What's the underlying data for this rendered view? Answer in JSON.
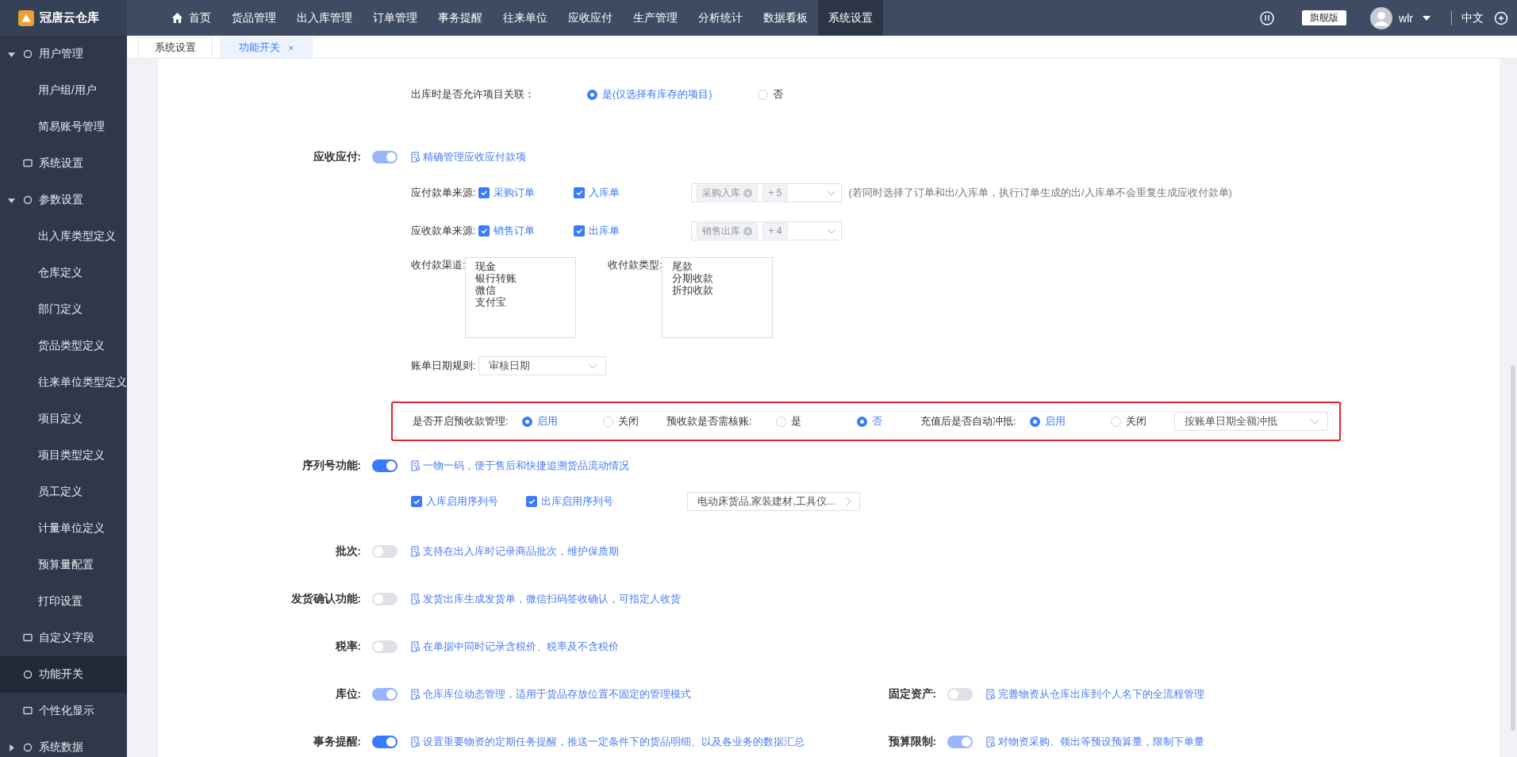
{
  "topbar": {
    "logo_text": "冠唐云仓库",
    "nav": [
      {
        "label": "首页",
        "selected": false
      },
      {
        "label": "货品管理",
        "selected": false
      },
      {
        "label": "出入库管理",
        "selected": false
      },
      {
        "label": "订单管理",
        "selected": false
      },
      {
        "label": "事务提醒",
        "selected": false
      },
      {
        "label": "往来单位",
        "selected": false
      },
      {
        "label": "应收应付",
        "selected": false
      },
      {
        "label": "生产管理",
        "selected": false
      },
      {
        "label": "分析统计",
        "selected": false
      },
      {
        "label": "数据看板",
        "selected": false
      },
      {
        "label": "系统设置",
        "selected": true
      }
    ],
    "edition": "旗舰版",
    "user": "wlr",
    "language": "中文"
  },
  "sidebar": {
    "items": [
      {
        "label": "用户管理",
        "selected": false,
        "expanded": true,
        "children": [
          {
            "label": "用户组/用户",
            "selected": false
          },
          {
            "label": "简易账号管理",
            "selected": false
          }
        ]
      },
      {
        "label": "系统设置",
        "selected": false
      },
      {
        "label": "参数设置",
        "selected": false,
        "expanded": true,
        "children": [
          {
            "label": "出入库类型定义",
            "selected": false
          },
          {
            "label": "仓库定义",
            "selected": false
          },
          {
            "label": "部门定义",
            "selected": false
          },
          {
            "label": "货品类型定义",
            "selected": false
          },
          {
            "label": "往来单位类型定义",
            "selected": false
          },
          {
            "label": "项目定义",
            "selected": false
          },
          {
            "label": "项目类型定义",
            "selected": false
          },
          {
            "label": "员工定义",
            "selected": false
          },
          {
            "label": "计量单位定义",
            "selected": false
          },
          {
            "label": "预算量配置",
            "selected": false
          },
          {
            "label": "打印设置",
            "selected": false
          }
        ]
      },
      {
        "label": "自定义字段",
        "selected": false
      },
      {
        "label": "功能开关",
        "selected": true
      },
      {
        "label": "个性化显示",
        "selected": false
      },
      {
        "label": "系统数据",
        "selected": false,
        "expanded": false
      }
    ]
  },
  "tabs": [
    {
      "label": "系统设置",
      "selected": false
    },
    {
      "label": "功能开关",
      "selected": true,
      "close": "×"
    }
  ],
  "project_link": {
    "label": "出库时是否允许项目关联：",
    "options": [
      {
        "label": "是(仅选择有库存的项目)",
        "selected": true
      },
      {
        "label": "否",
        "selected": false
      }
    ]
  },
  "receivable": {
    "label": "应收应付:",
    "on": true,
    "disabled": true,
    "description": "精确管理应收应付款项",
    "sources": [
      {
        "label": "应付款单来源:",
        "checks": [
          {
            "label": "采购订单",
            "checked": true
          },
          {
            "label": "入库单",
            "checked": true
          }
        ],
        "tags": [
          "采购入库"
        ],
        "more": "+ 5",
        "note": "(若同时选择了订单和出/入库单，执行订单生成的出/入库单不会重复生成应收付款单)"
      },
      {
        "label": "应收款单来源:",
        "checks": [
          {
            "label": "销售订单",
            "checked": true
          },
          {
            "label": "出库单",
            "checked": true
          }
        ],
        "tags": [
          "销售出库"
        ],
        "more": "+ 4"
      }
    ],
    "lists": [
      {
        "label": "收付款渠道:",
        "items": [
          "现金",
          "银行转账",
          "微信",
          "支付宝"
        ]
      },
      {
        "label": "收付款类型:",
        "items": [
          "尾款",
          "分期收款",
          "折扣收款"
        ]
      }
    ],
    "date_rule": {
      "label": "账单日期规则:",
      "value": "审核日期"
    },
    "prepay": {
      "groups": [
        {
          "label": "是否开启预收款管理:",
          "options": [
            {
              "label": "启用",
              "selected": true
            },
            {
              "label": "关闭",
              "selected": false
            }
          ]
        },
        {
          "label": "预收款是否需核账:",
          "options": [
            {
              "label": "是",
              "selected": false
            },
            {
              "label": "否",
              "selected": true
            }
          ]
        },
        {
          "label": "充值后是否自动冲抵:",
          "options": [
            {
              "label": "启用",
              "selected": true
            },
            {
              "label": "关闭",
              "selected": false
            }
          ]
        }
      ],
      "select": "按账单日期全额冲抵"
    }
  },
  "serial": {
    "label": "序列号功能:",
    "on": true,
    "disabled": false,
    "description": "一物一码，便于售后和快捷追溯货品流动情况",
    "checks": [
      {
        "label": "入库启用序列号",
        "checked": true
      },
      {
        "label": "出库启用序列号",
        "checked": true
      }
    ],
    "select": "电动床货品,家装建材,工具仪..."
  },
  "features": [
    [
      {
        "label": "批次:",
        "on": false,
        "disabled": false,
        "description": "支持在出入库时记录商品批次，维护保质期"
      }
    ],
    [
      {
        "label": "发货确认功能:",
        "on": false,
        "disabled": false,
        "description": "发货出库生成发货单，微信扫码签收确认，可指定人收货"
      }
    ],
    [
      {
        "label": "税率:",
        "on": false,
        "disabled": false,
        "description": "在单据中同时记录含税价、税率及不含税价"
      }
    ],
    [
      {
        "label": "库位:",
        "on": true,
        "disabled": true,
        "description": "仓库库位动态管理，适用于货品存放位置不固定的管理模式"
      },
      {
        "label": "固定资产:",
        "on": false,
        "disabled": false,
        "description": "完善物资从仓库出库到个人名下的全流程管理"
      }
    ],
    [
      {
        "label": "事务提醒:",
        "on": true,
        "disabled": false,
        "description": "设置重要物资的定期任务提醒，推送一定条件下的货品明细、以及各业务的数据汇总"
      },
      {
        "label": "预算限制:",
        "on": true,
        "disabled": true,
        "description": "对物资采购、领出等预设预算量，限制下单量"
      }
    ]
  ]
}
